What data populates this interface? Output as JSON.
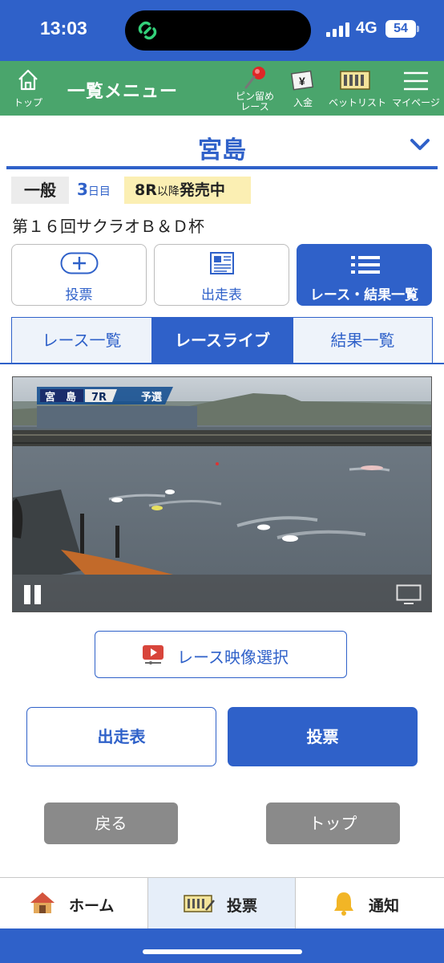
{
  "status_bar": {
    "time": "13:03",
    "network": "4G",
    "battery": "54"
  },
  "header": {
    "home_label": "トップ",
    "title": "一覧メニュー",
    "pin_label_line1": "ピン留め",
    "pin_label_line2": "レース",
    "deposit_label": "入金",
    "betlist_label": "ベットリスト",
    "mypage_label": "マイページ",
    "deposit_icon_text": "¥"
  },
  "venue": {
    "name": "宮島",
    "grade": "一般",
    "day_number": "3",
    "day_unit": "日目",
    "sale_race": "8R",
    "sale_suffix": "以降",
    "sale_status": "発売中",
    "race_title": "第１６回サクラオＢ＆Ｄ杯"
  },
  "actions": {
    "vote": "投票",
    "entry_table": "出走表",
    "results_list": "レース・結果一覧"
  },
  "tabs": [
    {
      "label": "レース一覧",
      "active": false
    },
    {
      "label": "レースライブ",
      "active": true
    },
    {
      "label": "結果一覧",
      "active": false
    }
  ],
  "video": {
    "overlay_venue": "宮　島",
    "overlay_race": "7R",
    "overlay_type": "予選"
  },
  "video_select_button": "レース映像選択",
  "buttons": {
    "entry_table": "出走表",
    "vote": "投票",
    "back": "戻る",
    "top": "トップ"
  },
  "bottom_nav": {
    "home": "ホーム",
    "vote": "投票",
    "notify": "通知"
  },
  "colors": {
    "primary": "#2f61c9",
    "header_green": "#4aa56c",
    "sale_badge": "#fbefb3",
    "gray_button": "#8a8a8a"
  },
  "icons": [
    "house-icon",
    "pin-icon",
    "deposit-icon",
    "betlist-icon",
    "menu-icon",
    "chevron-down-icon",
    "plus-circle-icon",
    "newspaper-icon",
    "list-icon",
    "pause-icon",
    "screen-icon",
    "video-icon",
    "bell-icon",
    "ticket-icon"
  ]
}
